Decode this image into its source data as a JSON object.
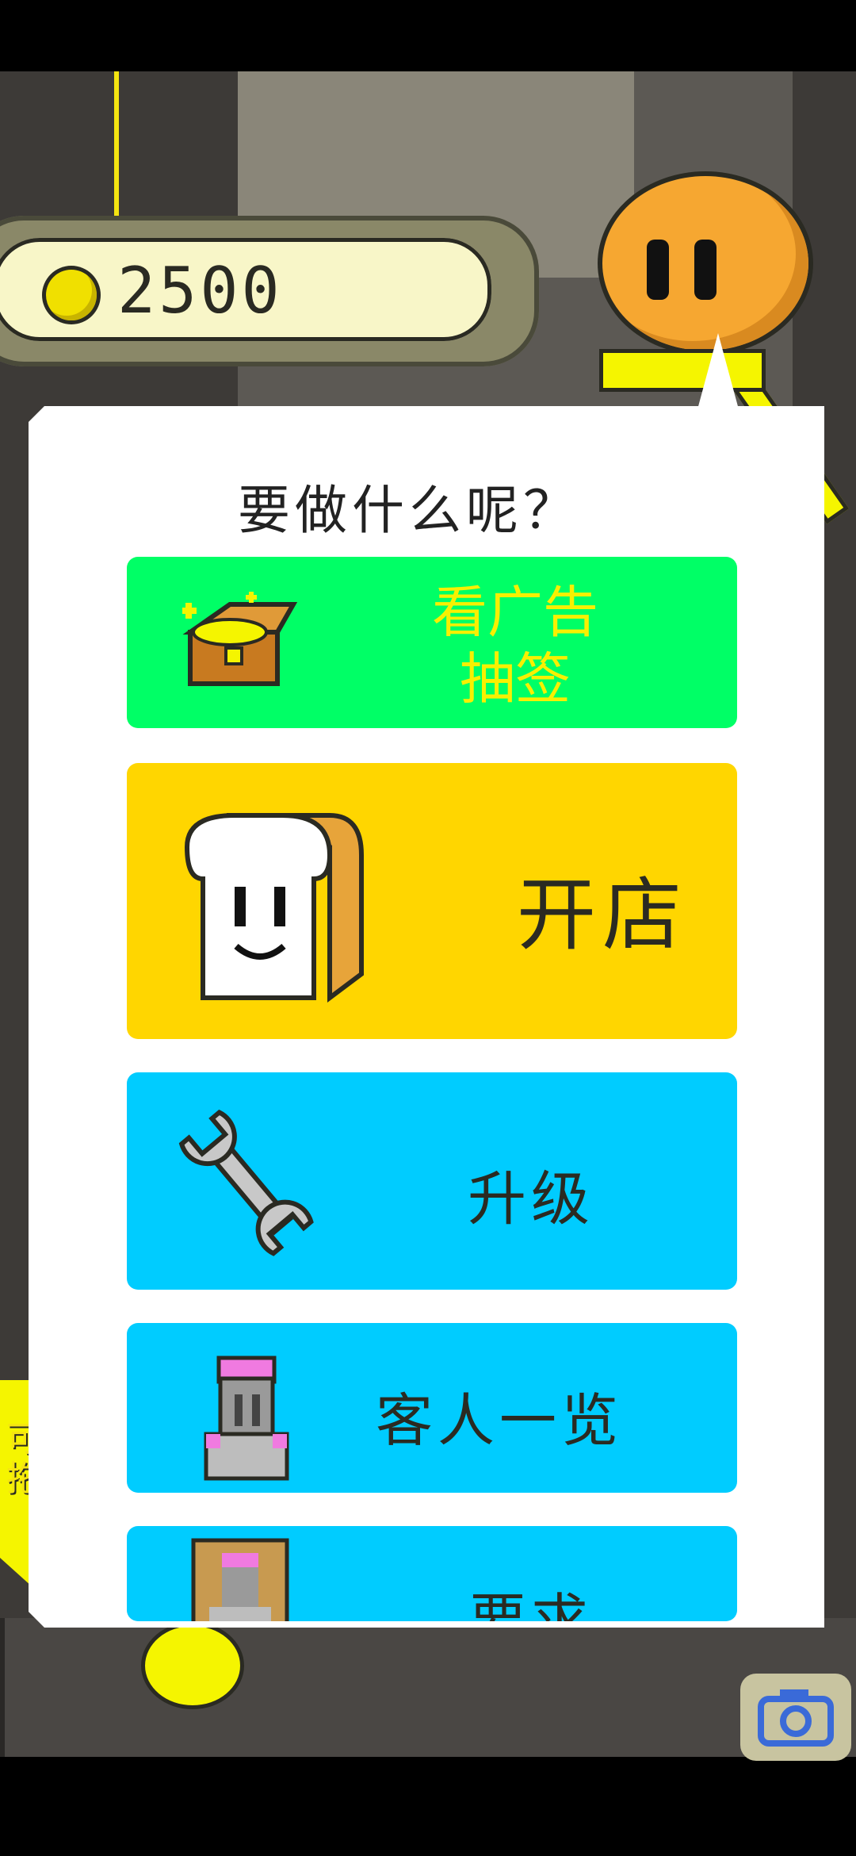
{
  "hud": {
    "coin_count": "2500",
    "coin_icon": "gold-coin-icon",
    "camera_icon": "camera-icon"
  },
  "dialog": {
    "title": "要做什么呢？",
    "buttons": [
      {
        "label": "看广告\n抽签",
        "icon": "treasure-chest-icon",
        "color": "#00ff66",
        "text_color": "#f8f000"
      },
      {
        "label": "开店",
        "icon": "bread-icon",
        "color": "#ffd600",
        "text_color": "#2a2a22"
      },
      {
        "label": "升级",
        "icon": "wrench-icon",
        "color": "#00ccff",
        "text_color": "#2a2a22"
      },
      {
        "label": "客人一览",
        "icon": "customer-icon",
        "color": "#00ccff",
        "text_color": "#2a2a22"
      },
      {
        "label": "要求",
        "icon": "customer-portrait-icon",
        "color": "#00ccff",
        "text_color": "#2a2a22"
      }
    ]
  },
  "hint": {
    "text": "可以\n拖动",
    "icon": "down-arrow-icon"
  },
  "colors": {
    "background": "#5c5954",
    "coinbar": "#f8f6c8",
    "character": "#f6a731"
  }
}
